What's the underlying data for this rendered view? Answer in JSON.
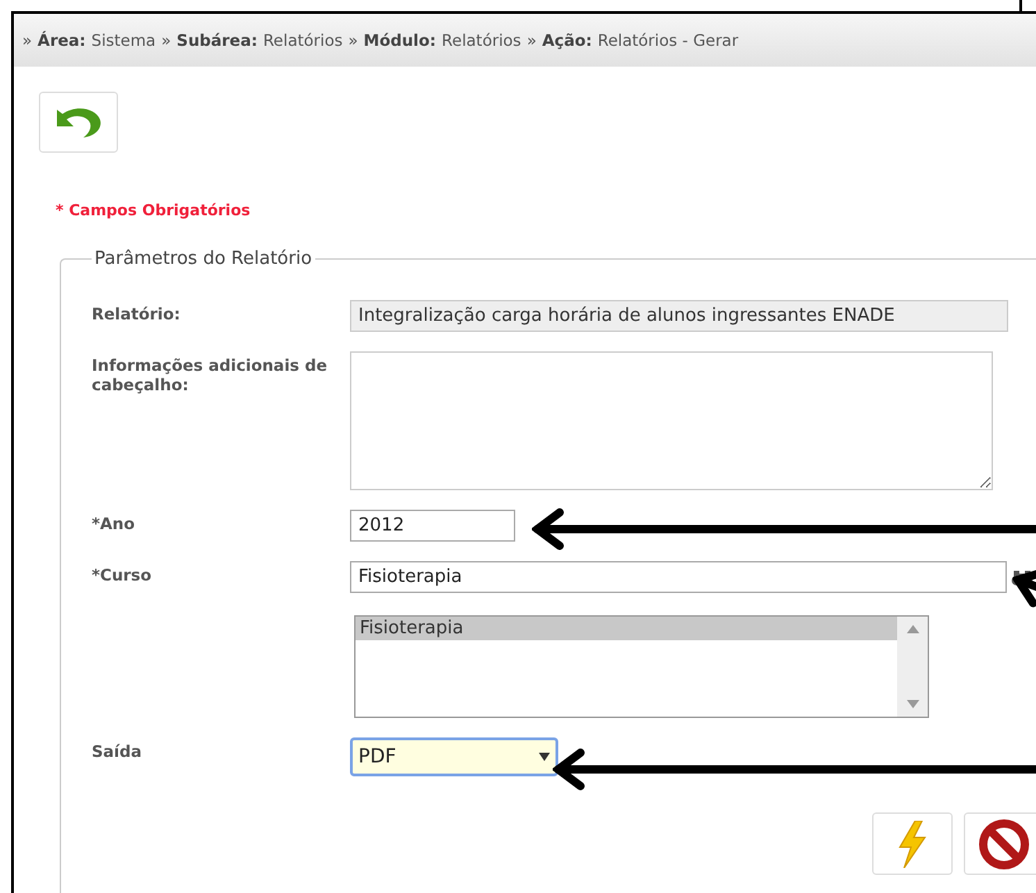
{
  "breadcrumb": [
    {
      "label": "Área:",
      "value": "Sistema"
    },
    {
      "label": "Subárea:",
      "value": "Relatórios"
    },
    {
      "label": "Módulo:",
      "value": "Relatórios"
    },
    {
      "label": "Ação:",
      "value": "Relatórios - Gerar"
    }
  ],
  "separator": "»",
  "required_note": "* Campos Obrigatórios",
  "fieldset": {
    "legend": "Parâmetros do Relatório",
    "fields": [
      {
        "kind": "readonly",
        "label": "Relatório:",
        "value": "Integralização carga horária de alunos ingressantes ENADE"
      },
      {
        "kind": "textarea",
        "label": "Informações adicionais de cabeçalho:"
      },
      {
        "kind": "text",
        "label": "*Ano",
        "value": "2012"
      },
      {
        "kind": "search",
        "label": "*Curso",
        "value": "Fisioterapia",
        "options": [
          {
            "label": "Fisioterapia",
            "selected": true
          }
        ]
      },
      {
        "kind": "select",
        "label": "Saída",
        "value": "PDF"
      }
    ]
  }
}
